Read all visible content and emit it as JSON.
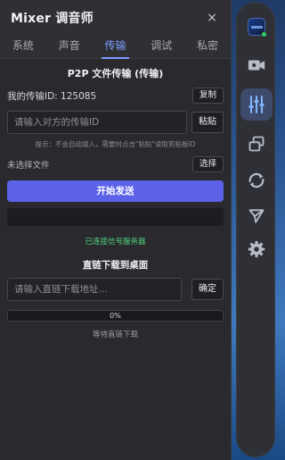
{
  "window": {
    "title": "Mixer 调音师",
    "close_glyph": "×"
  },
  "tabs": [
    {
      "label": "系统"
    },
    {
      "label": "声音"
    },
    {
      "label": "传输"
    },
    {
      "label": "调试"
    },
    {
      "label": "私密"
    }
  ],
  "active_tab": "传输",
  "transfer": {
    "section_title": "P2P 文件传输 (传输)",
    "my_id_text": "我的传输ID: 125085",
    "copy_label": "复制",
    "peer_placeholder": "请输入对方的传输ID",
    "paste_label": "粘贴",
    "hint": "提示：不会自动填入，需要时点击\"粘贴\"读取剪贴板ID",
    "no_file_text": "未选择文件",
    "choose_label": "选择",
    "start_label": "开始发送",
    "connection_status": "已连接信号服务器",
    "status_color": "#4fd47c"
  },
  "direct_download": {
    "title": "直链下载到桌面",
    "url_placeholder": "请输入直链下载地址...",
    "confirm_label": "确定",
    "progress_text": "0%",
    "progress_value": 0,
    "status_text": "等待直链下载"
  },
  "dock": {
    "items": [
      {
        "icon": "avatar-icon"
      },
      {
        "icon": "video-camera-icon"
      },
      {
        "icon": "mixer-sliders-icon",
        "active": true
      },
      {
        "icon": "windows-icon"
      },
      {
        "icon": "refresh-icon"
      },
      {
        "icon": "send-icon"
      },
      {
        "icon": "gear-icon"
      }
    ]
  },
  "colors": {
    "accent": "#5b62e8",
    "tab_active": "#7c9cff",
    "success": "#4fd47c"
  }
}
